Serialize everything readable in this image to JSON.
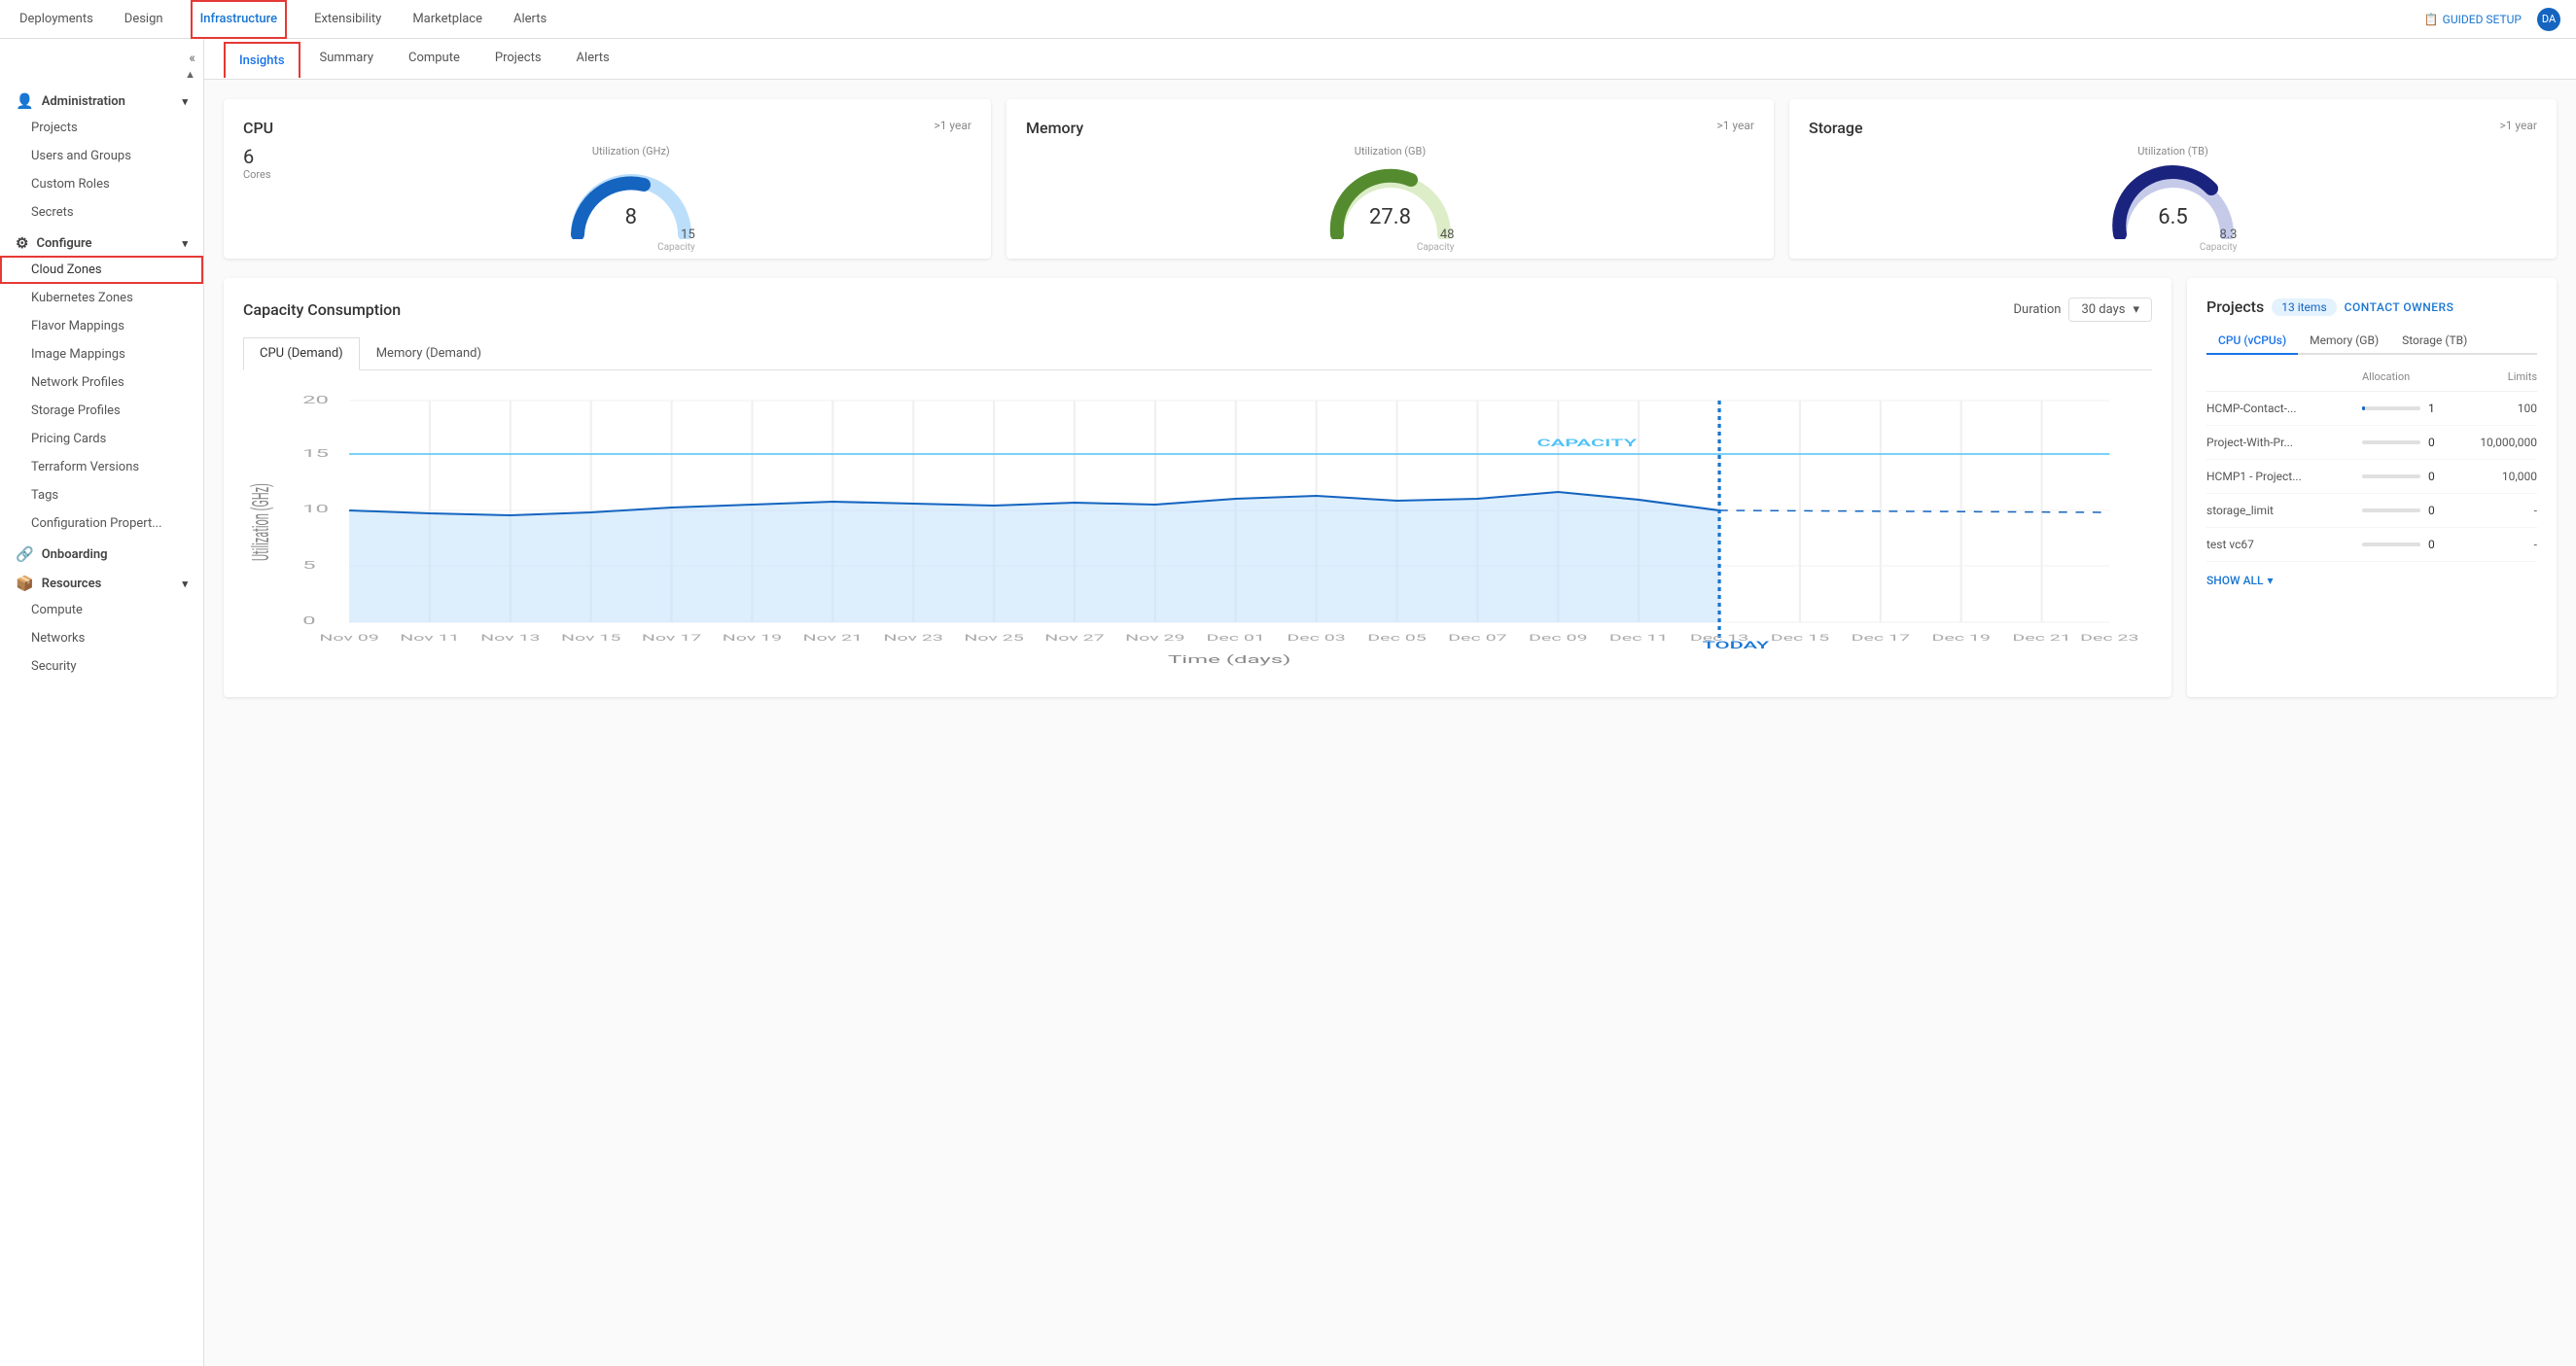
{
  "topNav": {
    "items": [
      {
        "label": "Deployments",
        "active": false
      },
      {
        "label": "Design",
        "active": false
      },
      {
        "label": "Infrastructure",
        "active": true
      },
      {
        "label": "Extensibility",
        "active": false
      },
      {
        "label": "Marketplace",
        "active": false
      },
      {
        "label": "Alerts",
        "active": false
      }
    ],
    "guidedSetup": "GUIDED SETUP",
    "darkMode": "DA"
  },
  "sidebar": {
    "collapseIcon": "«",
    "upIcon": "▲",
    "administration": {
      "label": "Administration",
      "icon": "👤",
      "items": [
        {
          "label": "Projects",
          "active": false
        },
        {
          "label": "Users and Groups",
          "active": false
        },
        {
          "label": "Custom Roles",
          "active": false
        },
        {
          "label": "Secrets",
          "active": false
        }
      ]
    },
    "configure": {
      "label": "Configure",
      "icon": "⚙",
      "items": [
        {
          "label": "Cloud Zones",
          "active": true,
          "highlighted": true
        },
        {
          "label": "Kubernetes Zones",
          "active": false
        },
        {
          "label": "Flavor Mappings",
          "active": false
        },
        {
          "label": "Image Mappings",
          "active": false
        },
        {
          "label": "Network Profiles",
          "active": false
        },
        {
          "label": "Storage Profiles",
          "active": false
        },
        {
          "label": "Pricing Cards",
          "active": false
        },
        {
          "label": "Terraform Versions",
          "active": false
        },
        {
          "label": "Tags",
          "active": false
        },
        {
          "label": "Configuration Propert...",
          "active": false
        }
      ]
    },
    "onboarding": {
      "label": "Onboarding",
      "icon": "🔗"
    },
    "resources": {
      "label": "Resources",
      "icon": "📦",
      "items": [
        {
          "label": "Compute",
          "active": false
        },
        {
          "label": "Networks",
          "active": false
        },
        {
          "label": "Security",
          "active": false
        }
      ]
    }
  },
  "subNav": {
    "items": [
      {
        "label": "Insights",
        "active": true
      },
      {
        "label": "Summary",
        "active": false
      },
      {
        "label": "Compute",
        "active": false
      },
      {
        "label": "Projects",
        "active": false
      },
      {
        "label": "Alerts",
        "active": false
      }
    ]
  },
  "cpu": {
    "title": "CPU",
    "timeframe": ">1 year",
    "cores": "6",
    "coresLabel": "Cores",
    "utilizationLabel": "Utilization (GHz)",
    "value": "8",
    "capacity": "15",
    "capacityLabel": "Capacity",
    "gaugeUsedColor": "#1565c0",
    "gaugeRemainColor": "#bbdefb"
  },
  "memory": {
    "title": "Memory",
    "timeframe": ">1 year",
    "utilizationLabel": "Utilization (GB)",
    "value": "27.8",
    "capacity": "48",
    "capacityLabel": "Capacity",
    "gaugeUsedColor": "#558b2f",
    "gaugeRemainColor": "#dcedc8"
  },
  "storage": {
    "title": "Storage",
    "timeframe": ">1 year",
    "utilizationLabel": "Utilization (TB)",
    "value": "6.5",
    "capacity": "8.3",
    "capacityLabel": "Capacity",
    "gaugeUsedColor": "#1a237e",
    "gaugeRemainColor": "#c5cae9"
  },
  "capacityConsumption": {
    "title": "Capacity Consumption",
    "durationLabel": "Duration",
    "duration": "30 days",
    "tabs": [
      {
        "label": "CPU (Demand)",
        "active": true
      },
      {
        "label": "Memory (Demand)",
        "active": false
      }
    ],
    "chartYLabel": "Utilization (GHz)",
    "chartXLabel": "Time (days)",
    "capacityLineLabel": "CAPACITY",
    "todayLabel": "TODAY",
    "yAxisMax": 20,
    "yAxis": [
      20,
      15,
      10,
      5,
      0
    ],
    "xLabels": [
      "Nov 09",
      "Nov 11",
      "Nov 13",
      "Nov 15",
      "Nov 17",
      "Nov 19",
      "Nov 21",
      "Nov 23",
      "Nov 25",
      "Nov 27",
      "Nov 29",
      "Dec 01",
      "Dec 03",
      "Dec 05",
      "Dec 07",
      "Dec 09",
      "Dec 11",
      "Dec 13",
      "Dec 15",
      "Dec 17",
      "Dec 19",
      "Dec 21",
      "Dec 23"
    ]
  },
  "projects": {
    "title": "Projects",
    "badgeCount": "13 items",
    "contactOwners": "CONTACT OWNERS",
    "tabs": [
      {
        "label": "CPU (vCPUs)",
        "active": true
      },
      {
        "label": "Memory (GB)",
        "active": false
      },
      {
        "label": "Storage (TB)",
        "active": false
      }
    ],
    "tableHeaders": {
      "name": "",
      "allocation": "Allocation",
      "limits": "Limits"
    },
    "rows": [
      {
        "name": "HCMP-Contact-...",
        "allocation": 1,
        "allocBar": 1,
        "limits": "100"
      },
      {
        "name": "Project-With-Pr...",
        "allocation": 0,
        "allocBar": 0,
        "limits": "10,000,000"
      },
      {
        "name": "HCMP1 - Project...",
        "allocation": 0,
        "allocBar": 0,
        "limits": "10,000"
      },
      {
        "name": "storage_limit",
        "allocation": 0,
        "allocBar": 0,
        "limits": "-"
      },
      {
        "name": "test vc67",
        "allocation": 0,
        "allocBar": 0,
        "limits": "-"
      }
    ],
    "showAll": "SHOW ALL"
  }
}
